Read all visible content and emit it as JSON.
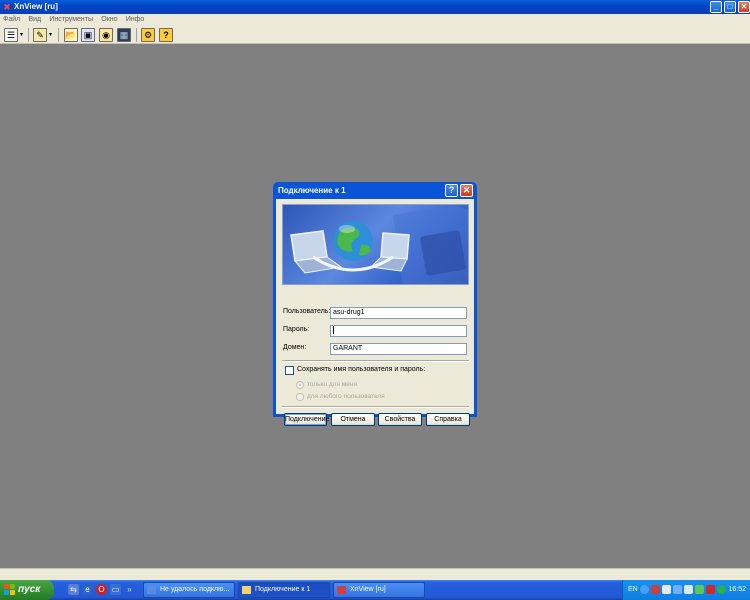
{
  "window": {
    "title": "XnView [ru]"
  },
  "menu": [
    "Файл",
    "Вид",
    "Инструменты",
    "Окно",
    "Инфо"
  ],
  "dialog": {
    "title": "Подключение к 1",
    "fields": {
      "user_label": "Пользователь:",
      "user_value": "asu-drug1",
      "password_label": "Пароль:",
      "password_value": "",
      "domain_label": "Домен:",
      "domain_value": "GARANT"
    },
    "save_checkbox_label": "Сохранять имя пользователя и пароль:",
    "radio_me": "только для меня",
    "radio_any": "для любого пользователя",
    "buttons": {
      "connect": "Подключение",
      "cancel": "Отмена",
      "properties": "Свойства",
      "help": "Справка"
    }
  },
  "taskbar": {
    "start_label": "пуск",
    "tasks": [
      {
        "label": "Не удалось подклю..."
      },
      {
        "label": "Подключение к 1"
      },
      {
        "label": "XnView [ru]"
      }
    ],
    "tray": {
      "language": "EN",
      "time": "16:52"
    }
  },
  "colors": {
    "desktop": "#808080",
    "titlebar": "#0a54d8",
    "start": "#2f8c2f",
    "dialog_face": "#ece9d8"
  }
}
